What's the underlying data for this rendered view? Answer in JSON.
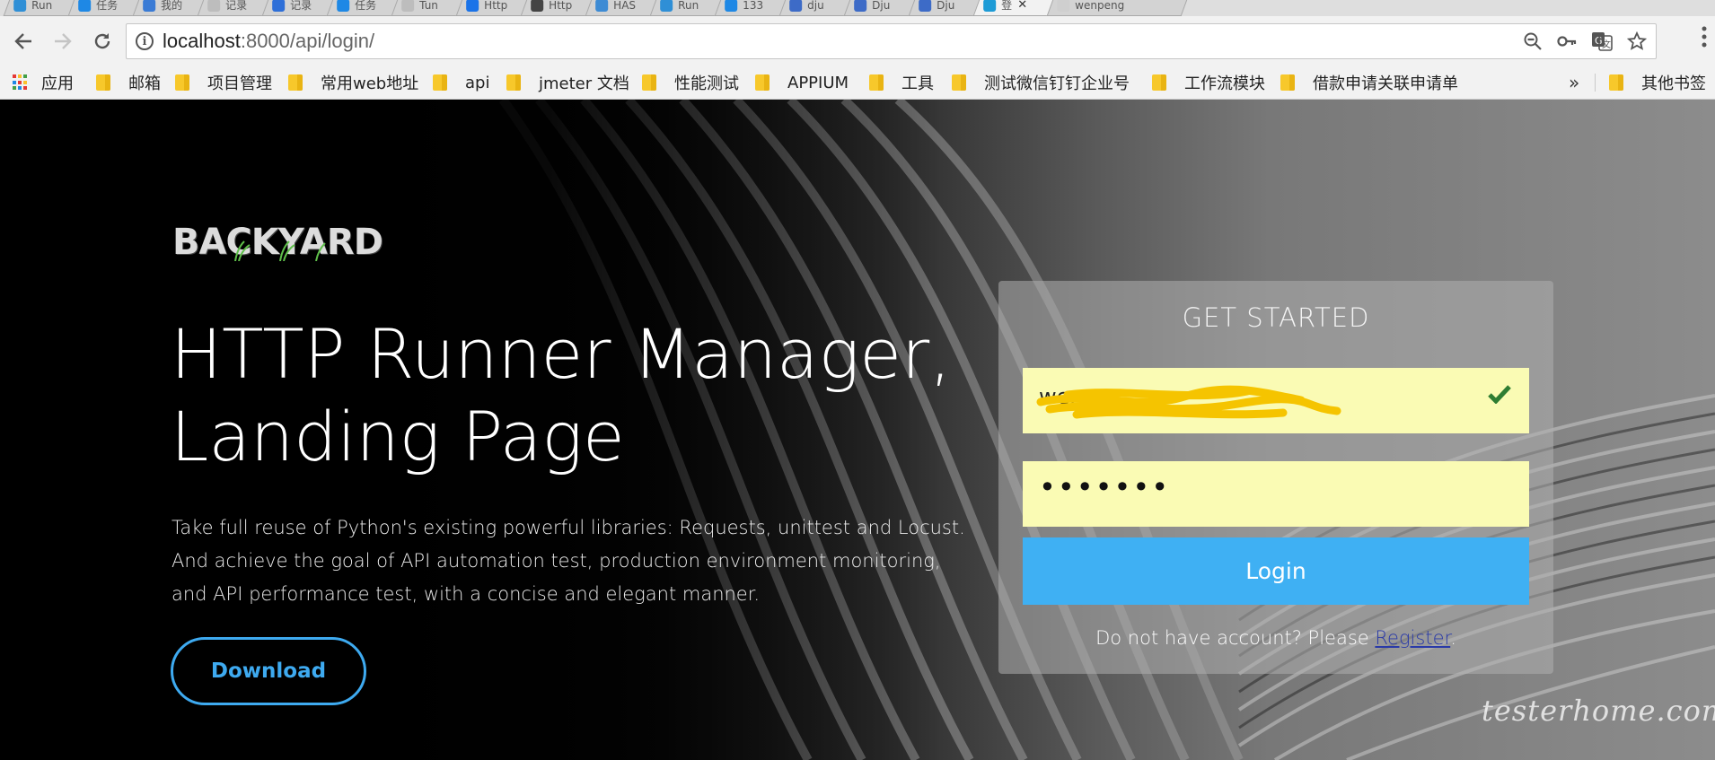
{
  "browser": {
    "tabs": [
      {
        "label": "Run",
        "fav": "#2f8fd6"
      },
      {
        "label": "任务",
        "fav": "#1e88e5"
      },
      {
        "label": "我的",
        "fav": "#3a7bd5"
      },
      {
        "label": "记录",
        "fav": "#bdbdbd"
      },
      {
        "label": "记录",
        "fav": "#2e6fd8"
      },
      {
        "label": "任务",
        "fav": "#1e88e5"
      },
      {
        "label": "Tun",
        "fav": "#bdbdbd"
      },
      {
        "label": "Http",
        "fav": "#1a73e8"
      },
      {
        "label": "Http",
        "fav": "#444444"
      },
      {
        "label": "HAS",
        "fav": "#3d8bd4"
      },
      {
        "label": "Run",
        "fav": "#2f8fd6"
      },
      {
        "label": "133",
        "fav": "#1e88e5"
      },
      {
        "label": "dju",
        "fav": "#3d6bc7"
      },
      {
        "label": "Dju",
        "fav": "#3d6bc7"
      },
      {
        "label": "Dju",
        "fav": "#3d6bc7"
      },
      {
        "label": "登",
        "fav": "#1d9bd6",
        "active": true
      },
      {
        "label": "wenpeng",
        "fav": "#cfcfcf"
      }
    ],
    "active_tab_close": "✕",
    "url_host": "localhost",
    "url_rest": ":8000/api/login/",
    "icons": [
      "zoom-icon",
      "key-icon",
      "translate-icon",
      "star-icon"
    ]
  },
  "bookmarks": {
    "apps_label": "应用",
    "items": [
      {
        "label": "邮箱"
      },
      {
        "label": "项目管理"
      },
      {
        "label": "常用web地址"
      },
      {
        "label": "api"
      },
      {
        "label": "jmeter 文档"
      },
      {
        "label": "性能测试"
      },
      {
        "label": "APPIUM"
      },
      {
        "label": "工具"
      },
      {
        "label": "测试微信钉钉企业号"
      },
      {
        "label": "工作流模块"
      },
      {
        "label": "借款申请关联申请单"
      }
    ],
    "overflow": "»",
    "other": "其他书签"
  },
  "page": {
    "logo": "BACKYARD",
    "title_line1": "HTTP Runner Manager,",
    "title_line2": "Landing Page",
    "desc_line1": "Take full reuse of Python's existing powerful libraries: Requests, unittest and Locust.",
    "desc_line2": "And achieve the goal of API automation test, production environment monitoring,",
    "desc_line3": "and API performance test, with a concise and elegant manner.",
    "download_label": "Download",
    "watermark": "testerhome.com"
  },
  "login": {
    "title": "GET STARTED",
    "email_value": "wen",
    "password_value": "•••••••",
    "login_label": "Login",
    "register_prefix": "Do not have account? Please ",
    "register_link": "Register",
    "register_suffix": "."
  },
  "colors": {
    "accent": "#3fb0f3",
    "input_bg": "#fafbb4",
    "check": "#2e7d32"
  }
}
